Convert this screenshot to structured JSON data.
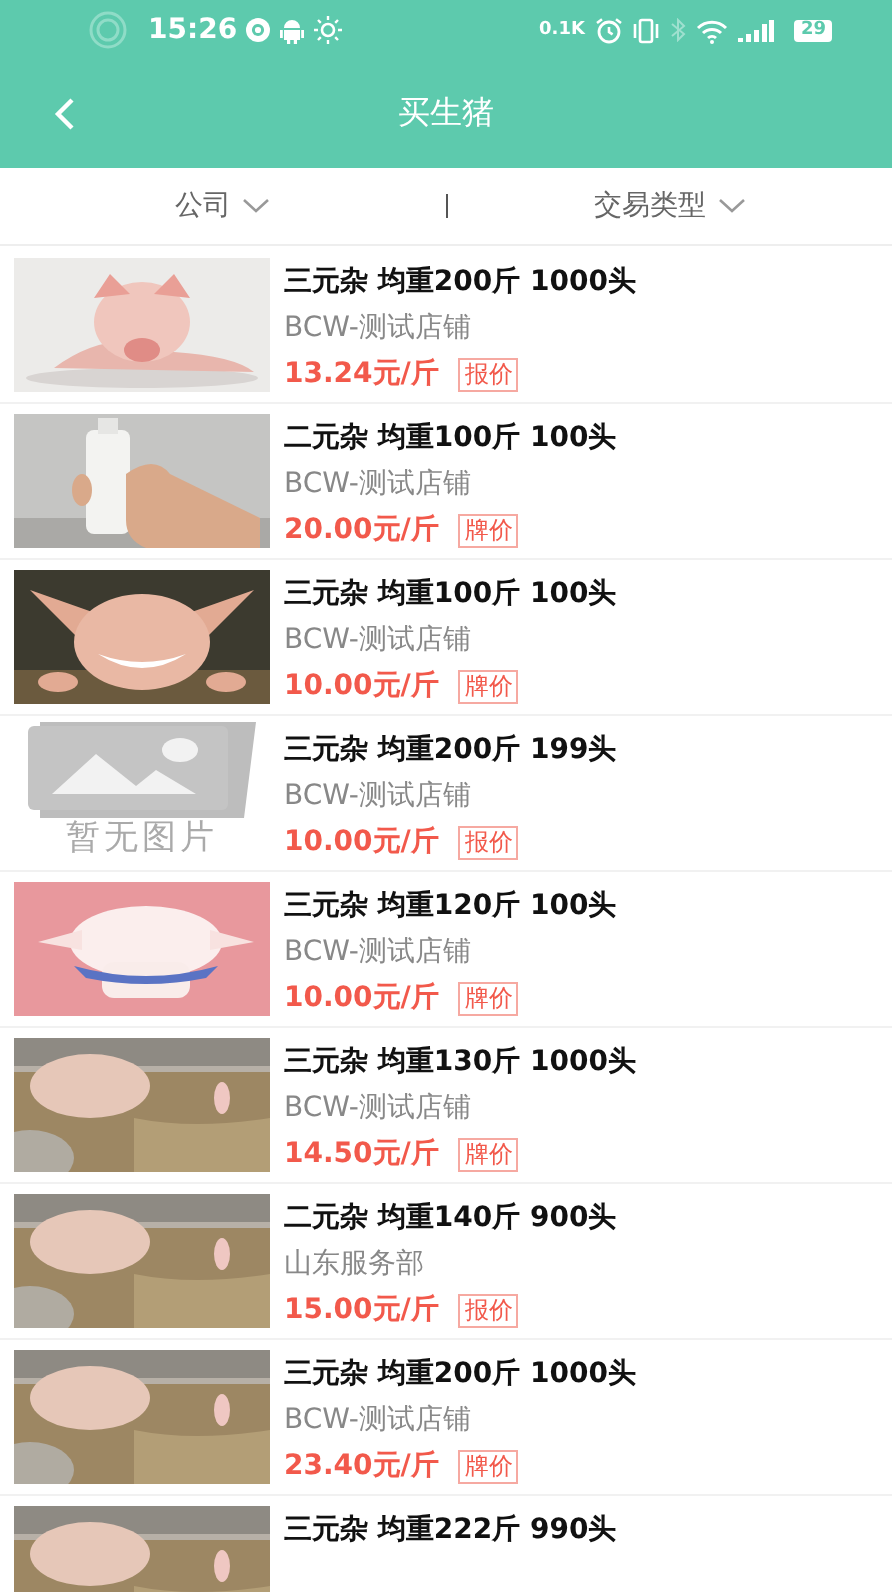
{
  "status_bar": {
    "time": "15:26",
    "net_speed": "0.1K",
    "battery": "29"
  },
  "header": {
    "title": "买生猪"
  },
  "filters": [
    {
      "label": "公司"
    },
    {
      "label": "交易类型"
    }
  ],
  "listings": [
    {
      "title": "三元杂 均重200斤 1000头",
      "shop": "BCW-测试店铺",
      "price": "13.24元/斤",
      "price_type": "报价"
    },
    {
      "title": "二元杂 均重100斤 100头",
      "shop": "BCW-测试店铺",
      "price": "20.00元/斤",
      "price_type": "牌价"
    },
    {
      "title": "三元杂 均重100斤 100头",
      "shop": "BCW-测试店铺",
      "price": "10.00元/斤",
      "price_type": "牌价"
    },
    {
      "title": "三元杂 均重200斤 199头",
      "shop": "BCW-测试店铺",
      "price": "10.00元/斤",
      "price_type": "报价",
      "image": {
        "kind": "placeholder",
        "text": "暂无图片"
      }
    },
    {
      "title": "三元杂 均重120斤 100头",
      "shop": "BCW-测试店铺",
      "price": "10.00元/斤",
      "price_type": "牌价"
    },
    {
      "title": "三元杂 均重130斤 1000头",
      "shop": "BCW-测试店铺",
      "price": "14.50元/斤",
      "price_type": "牌价"
    },
    {
      "title": "二元杂 均重140斤 900头",
      "shop": "山东服务部",
      "price": "15.00元/斤",
      "price_type": "报价"
    },
    {
      "title": "三元杂 均重200斤 1000头",
      "shop": "BCW-测试店铺",
      "price": "23.40元/斤",
      "price_type": "牌价"
    },
    {
      "title": "三元杂 均重222斤 990头"
    }
  ]
}
